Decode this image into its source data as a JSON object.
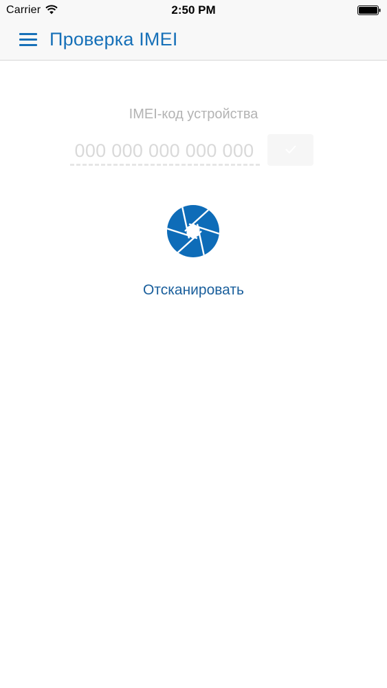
{
  "status_bar": {
    "carrier": "Carrier",
    "time": "2:50 PM",
    "wifi_icon": "wifi-icon",
    "battery_icon": "battery-icon"
  },
  "nav": {
    "menu_icon": "hamburger-menu-icon",
    "title": "Проверка IMEI"
  },
  "imei": {
    "label": "IMEI-код устройства",
    "value": "",
    "placeholder": "000 000 000 000 000",
    "submit_icon": "check-icon"
  },
  "scan": {
    "icon": "camera-aperture-icon",
    "label": "Отсканировать"
  },
  "colors": {
    "accent": "#1670b8",
    "scan_icon": "#0e6cb8",
    "scan_label": "#1a5f9c",
    "label_gray": "#b3b3b3",
    "placeholder_gray": "#d9d9d9",
    "bar_background": "#f8f8f8"
  }
}
